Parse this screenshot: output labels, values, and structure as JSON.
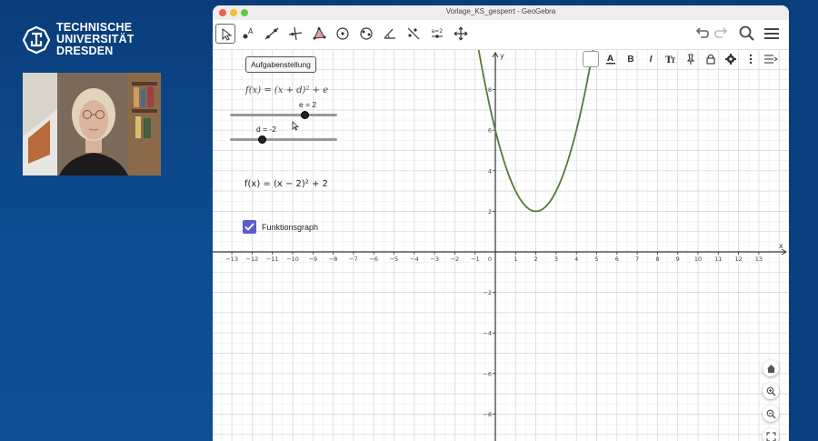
{
  "university": {
    "lines": [
      "TECHNISCHE",
      "UNIVERSITÄT",
      "DRESDEN"
    ]
  },
  "window": {
    "title": "Vorlage_KS_gesperrt - GeoGebra"
  },
  "toolbar": {
    "tools": [
      {
        "name": "move-tool-icon",
        "selected": true
      },
      {
        "name": "point-tool-icon"
      },
      {
        "name": "line-tool-icon"
      },
      {
        "name": "perpendicular-line-tool-icon"
      },
      {
        "name": "polygon-tool-icon"
      },
      {
        "name": "circle-tool-icon"
      },
      {
        "name": "circle-through-points-tool-icon"
      },
      {
        "name": "angle-tool-icon"
      },
      {
        "name": "reflect-tool-icon"
      },
      {
        "name": "slider-tool-icon",
        "label": "a=2"
      },
      {
        "name": "move-view-tool-icon"
      }
    ],
    "right": [
      "undo-icon",
      "redo-icon",
      "search-icon",
      "menu-icon"
    ]
  },
  "style_bar": {
    "items": [
      "color-swatch",
      "text-color-icon",
      "B",
      "I",
      "serif-font-icon",
      "pin-icon",
      "lock-icon",
      "settings-gear-icon",
      "more-options-icon",
      "toggle-style-bar-icon"
    ],
    "bold_label": "B",
    "italic_label": "I"
  },
  "algebra": {
    "task_button": "Aufgabenstellung",
    "general_formula": "f(x) = (x + d)² + e",
    "slider_e": {
      "label": "e = 2",
      "value": 2
    },
    "slider_d": {
      "label": "d = -2",
      "value": -2
    },
    "specific_formula": "f(x) = (x − 2)² + 2",
    "checkbox": {
      "label": "Funktionsgraph",
      "checked": true
    }
  },
  "graph": {
    "x_axis_label": "x",
    "y_axis_label": "y",
    "x_ticks": [
      -13,
      -12,
      -11,
      -10,
      -9,
      -8,
      -7,
      -6,
      -5,
      -4,
      -3,
      -2,
      -1,
      0,
      1,
      2,
      3,
      4,
      5,
      6,
      7,
      8,
      9,
      10,
      11,
      12,
      13
    ],
    "y_ticks": [
      -8,
      -6,
      -4,
      -2,
      2,
      4,
      6,
      8
    ],
    "grid": true,
    "curve_color": "#527a3a",
    "axis_color": "#333333",
    "function": {
      "d": -2,
      "e": 2
    }
  },
  "colors": {
    "background": "#0d4d92",
    "checkbox": "#5b5ec9"
  },
  "zoom_controls": [
    "home-icon",
    "zoom-in-icon",
    "zoom-out-icon",
    "fullscreen-icon"
  ]
}
